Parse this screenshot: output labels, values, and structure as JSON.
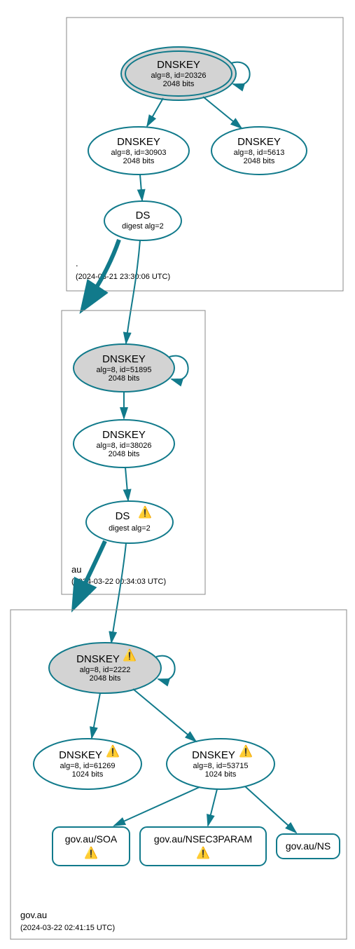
{
  "zones": {
    "root": {
      "label": ".",
      "timestamp": "(2024-03-21 23:30:06 UTC)",
      "ksk": {
        "title": "DNSKEY",
        "detail": "alg=8, id=20326",
        "bits": "2048 bits"
      },
      "zsk1": {
        "title": "DNSKEY",
        "detail": "alg=8, id=30903",
        "bits": "2048 bits"
      },
      "zsk2": {
        "title": "DNSKEY",
        "detail": "alg=8, id=5613",
        "bits": "2048 bits"
      },
      "ds": {
        "title": "DS",
        "detail": "digest alg=2"
      }
    },
    "au": {
      "label": "au",
      "timestamp": "(2024-03-22 00:34:03 UTC)",
      "ksk": {
        "title": "DNSKEY",
        "detail": "alg=8, id=51895",
        "bits": "2048 bits"
      },
      "zsk": {
        "title": "DNSKEY",
        "detail": "alg=8, id=38026",
        "bits": "2048 bits"
      },
      "ds": {
        "title": "DS",
        "detail": "digest alg=2",
        "warn": true
      }
    },
    "govau": {
      "label": "gov.au",
      "timestamp": "(2024-03-22 02:41:15 UTC)",
      "ksk": {
        "title": "DNSKEY",
        "detail": "alg=8, id=2222",
        "bits": "2048 bits",
        "warn": true
      },
      "zsk1": {
        "title": "DNSKEY",
        "detail": "alg=8, id=61269",
        "bits": "1024 bits",
        "warn": true
      },
      "zsk2": {
        "title": "DNSKEY",
        "detail": "alg=8, id=53715",
        "bits": "1024 bits",
        "warn": true
      },
      "rr1": {
        "title": "gov.au/SOA",
        "warn": true
      },
      "rr2": {
        "title": "gov.au/NSEC3PARAM",
        "warn": true
      },
      "rr3": {
        "title": "gov.au/NS"
      }
    }
  },
  "chart_data": {
    "type": "diagram",
    "description": "DNSSEC chain of trust graph",
    "zones": [
      {
        "name": ".",
        "timestamp": "2024-03-21 23:30:06 UTC",
        "nodes": [
          {
            "id": "root-ksk",
            "type": "DNSKEY",
            "role": "KSK",
            "alg": 8,
            "key_id": 20326,
            "bits": 2048
          },
          {
            "id": "root-zsk1",
            "type": "DNSKEY",
            "role": "ZSK",
            "alg": 8,
            "key_id": 30903,
            "bits": 2048
          },
          {
            "id": "root-zsk2",
            "type": "DNSKEY",
            "role": "ZSK",
            "alg": 8,
            "key_id": 5613,
            "bits": 2048
          },
          {
            "id": "root-ds",
            "type": "DS",
            "digest_alg": 2
          }
        ],
        "edges": [
          {
            "from": "root-ksk",
            "to": "root-ksk"
          },
          {
            "from": "root-ksk",
            "to": "root-zsk1"
          },
          {
            "from": "root-ksk",
            "to": "root-zsk2"
          },
          {
            "from": "root-zsk1",
            "to": "root-ds"
          }
        ]
      },
      {
        "name": "au",
        "timestamp": "2024-03-22 00:34:03 UTC",
        "nodes": [
          {
            "id": "au-ksk",
            "type": "DNSKEY",
            "role": "KSK",
            "alg": 8,
            "key_id": 51895,
            "bits": 2048
          },
          {
            "id": "au-zsk",
            "type": "DNSKEY",
            "role": "ZSK",
            "alg": 8,
            "key_id": 38026,
            "bits": 2048
          },
          {
            "id": "au-ds",
            "type": "DS",
            "digest_alg": 2,
            "warning": true
          }
        ],
        "edges": [
          {
            "from": "root-ds",
            "to": "au-ksk",
            "delegation": true
          },
          {
            "from": "au-ksk",
            "to": "au-ksk"
          },
          {
            "from": "au-ksk",
            "to": "au-zsk"
          },
          {
            "from": "au-zsk",
            "to": "au-ds"
          }
        ]
      },
      {
        "name": "gov.au",
        "timestamp": "2024-03-22 02:41:15 UTC",
        "nodes": [
          {
            "id": "govau-ksk",
            "type": "DNSKEY",
            "role": "KSK",
            "alg": 8,
            "key_id": 2222,
            "bits": 2048,
            "warning": true
          },
          {
            "id": "govau-zsk1",
            "type": "DNSKEY",
            "role": "ZSK",
            "alg": 8,
            "key_id": 61269,
            "bits": 1024,
            "warning": true
          },
          {
            "id": "govau-zsk2",
            "type": "DNSKEY",
            "role": "ZSK",
            "alg": 8,
            "key_id": 53715,
            "bits": 1024,
            "warning": true
          },
          {
            "id": "govau-soa",
            "type": "RRset",
            "name": "gov.au/SOA",
            "warning": true
          },
          {
            "id": "govau-nsec3",
            "type": "RRset",
            "name": "gov.au/NSEC3PARAM",
            "warning": true
          },
          {
            "id": "govau-ns",
            "type": "RRset",
            "name": "gov.au/NS"
          }
        ],
        "edges": [
          {
            "from": "au-ds",
            "to": "govau-ksk",
            "delegation": true
          },
          {
            "from": "govau-ksk",
            "to": "govau-ksk"
          },
          {
            "from": "govau-ksk",
            "to": "govau-zsk1"
          },
          {
            "from": "govau-ksk",
            "to": "govau-zsk2"
          },
          {
            "from": "govau-zsk2",
            "to": "govau-soa"
          },
          {
            "from": "govau-zsk2",
            "to": "govau-nsec3"
          },
          {
            "from": "govau-zsk2",
            "to": "govau-ns"
          }
        ]
      }
    ]
  }
}
